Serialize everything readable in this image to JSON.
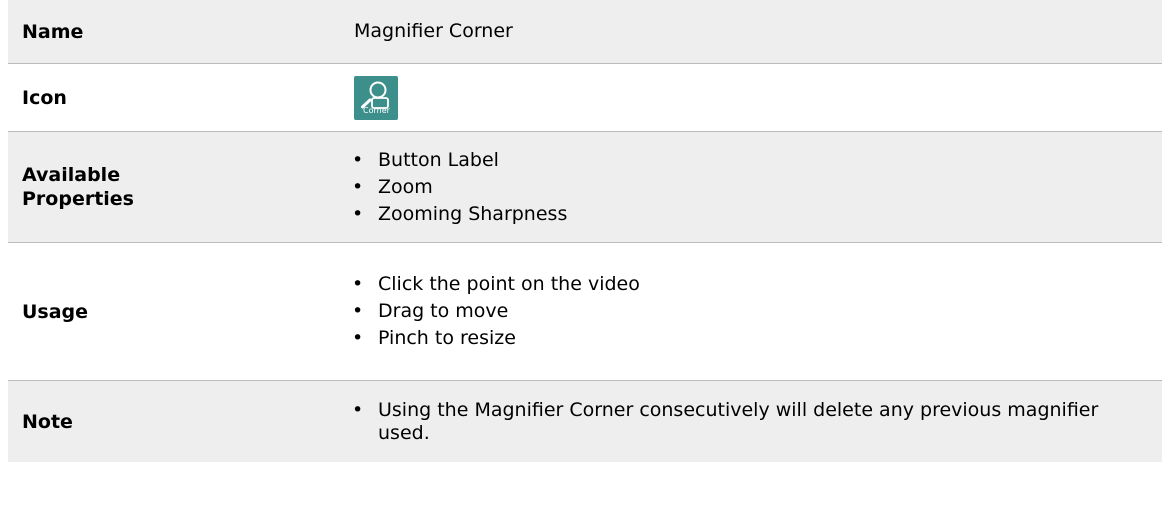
{
  "rows": {
    "name": {
      "label": "Name",
      "value": "Magnifier Corner"
    },
    "icon": {
      "label": "Icon",
      "icon_name": "magnifier-corner-icon",
      "icon_caption": "Corner",
      "icon_color": "#3c8f8b"
    },
    "properties": {
      "label_line1": "Available",
      "label_line2": "Properties",
      "items": [
        "Button Label",
        "Zoom",
        "Zooming Sharpness"
      ]
    },
    "usage": {
      "label": "Usage",
      "items": [
        "Click the point on the video",
        "Drag to move",
        "Pinch to resize"
      ]
    },
    "note": {
      "label": "Note",
      "items": [
        "Using the Magnifier Corner consecutively will delete any previous magnifier used."
      ]
    }
  }
}
